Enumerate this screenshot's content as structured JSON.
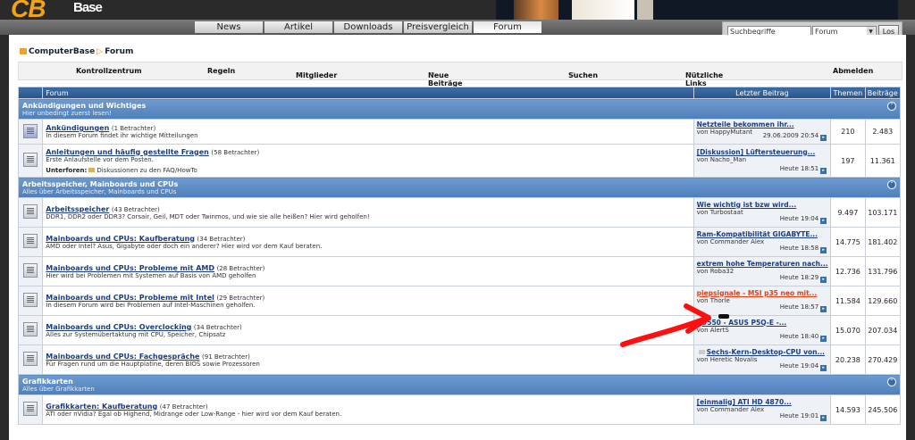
{
  "brand": {
    "logo_main": "CB",
    "logo_base": "Base"
  },
  "nav": {
    "tabs": [
      "News",
      "Artikel",
      "Downloads",
      "Preisvergleich",
      "Forum"
    ],
    "active": "Forum"
  },
  "search": {
    "placeholder": "Suchbegriffe eingeben",
    "scope": "Forum",
    "button": "Los"
  },
  "breadcrumb": {
    "home": "ComputerBase",
    "current": "Forum"
  },
  "subnav": [
    "Kontrollzentrum",
    "Regeln",
    "Mitglieder",
    "Neue Beiträge",
    "Suchen",
    "Nützliche Links",
    "Abmelden"
  ],
  "table_header": {
    "forum": "Forum",
    "last": "Letzter Beitrag",
    "threads": "Themen",
    "posts": "Beiträge"
  },
  "categories": [
    {
      "title": "Ankündigungen und Wichtiges",
      "subtitle": "Hier unbedingt zuerst lesen!",
      "forums": [
        {
          "name": "Ankündigungen",
          "viewers": "(1 Betrachter)",
          "desc": "In diesem Forum findet ihr wichtige Mitteilungen",
          "sub": "",
          "last_title": "Netzteile bekommen ihr...",
          "last_by": "von HappyMutant",
          "last_when": "29.06.2009 20:54",
          "threads": "210",
          "posts": "2.483"
        },
        {
          "name": "Anleitungen und häufig gestellte Fragen",
          "viewers": "(58 Betrachter)",
          "desc": "Erste Anlaufstelle vor dem Posten.",
          "sub_label": "Unterforen:",
          "sub": "Diskussionen zu den FAQ/HowTo",
          "last_title": "[Diskussion] Lüftersteuerung...",
          "last_by": "von Nacho_Man",
          "last_when": "Heute 18:51",
          "threads": "197",
          "posts": "11.361"
        }
      ]
    },
    {
      "title": "Arbeitsspeicher, Mainboards und CPUs",
      "subtitle": "Alles über Arbeitsspeicher, Mainboards und CPUs",
      "forums": [
        {
          "name": "Arbeitsspeicher",
          "viewers": "(43 Betrachter)",
          "desc": "DDR1, DDR2 oder DDR3? Corsair, Geil, MDT oder Twinmos, und wie sie alle heißen? Hier wird geholfen!",
          "sub": "",
          "last_title": "Wie wichtig ist bzw wird...",
          "last_by": "von Turbostaat",
          "last_when": "Heute 19:04",
          "threads": "9.497",
          "posts": "103.171"
        },
        {
          "name": "Mainboards und CPUs: Kaufberatung",
          "viewers": "(34 Betrachter)",
          "desc": "AMD oder Intel? Asus, Gigabyte oder doch ein anderer? Hier wird vor dem Kauf beraten.",
          "sub": "",
          "last_title": "Ram-Kompatibilität GIGABYTE...",
          "last_by": "von Commander Alex",
          "last_when": "Heute 18:58",
          "threads": "14.775",
          "posts": "181.402"
        },
        {
          "name": "Mainboards und CPUs: Probleme mit AMD",
          "viewers": "(28 Betrachter)",
          "desc": "Hier wird bei Problemen mit Systemen auf Basis von AMD geholfen",
          "sub": "",
          "last_title": "extrem hohe Temperaturen nach...",
          "last_by": "von Roba32",
          "last_when": "Heute 18:29",
          "threads": "12.736",
          "posts": "131.796"
        },
        {
          "name": "Mainboards und CPUs: Probleme mit Intel",
          "viewers": "(29 Betrachter)",
          "desc": "In diesem Forum wird bei Problemen auf Intel-Maschinen geholfen.",
          "sub": "",
          "last_title": "piepsignale - MSI p35 neo mit...",
          "last_by": "von Thorle",
          "last_when": "Heute 18:57",
          "threads": "11.584",
          "posts": "129.660",
          "highlight": true
        },
        {
          "name": "Mainboards und CPUs: Overclocking",
          "viewers": "(34 Betrachter)",
          "desc": "Alles zur Systemübertaktung mit CPU, Speicher, Chipsatz",
          "sub": "",
          "last_title": "Q9550 - ASUS P5Q-E -...",
          "last_by": "von AlertS",
          "last_when": "Heute 18:40",
          "threads": "15.070",
          "posts": "207.034"
        },
        {
          "name": "Mainboards und CPUs: Fachgespräche",
          "viewers": "(91 Betrachter)",
          "desc": "Für Fragen rund um die Hauptplatine, deren BIOS sowie Prozessoren",
          "sub": "",
          "last_title": "Sechs-Kern-Desktop-CPU von...",
          "last_by": "von Heretic Novalis",
          "last_when": "Heute 19:04",
          "threads": "20.238",
          "posts": "270.429"
        }
      ]
    },
    {
      "title": "Grafikkarten",
      "subtitle": "Alles über Grafikkarten",
      "forums": [
        {
          "name": "Grafikkarten: Kaufberatung",
          "viewers": "(47 Betrachter)",
          "desc": "ATI oder nVidia? Egal ob Highend, Midrange oder Low-Range - hier wird vor dem Kauf beraten.",
          "sub": "",
          "last_title": "[einmalig] ATI HD 4870...",
          "last_by": "von Commander Alex",
          "last_when": "Heute 19:01",
          "threads": "14.593",
          "posts": "245.506"
        }
      ]
    }
  ],
  "colors": {
    "accent": "#f3a316",
    "header_blue": "#2a548a",
    "category_blue": "#5f8fc8",
    "link_blue": "#1a3d86",
    "annotation_red": "#ff1010"
  }
}
